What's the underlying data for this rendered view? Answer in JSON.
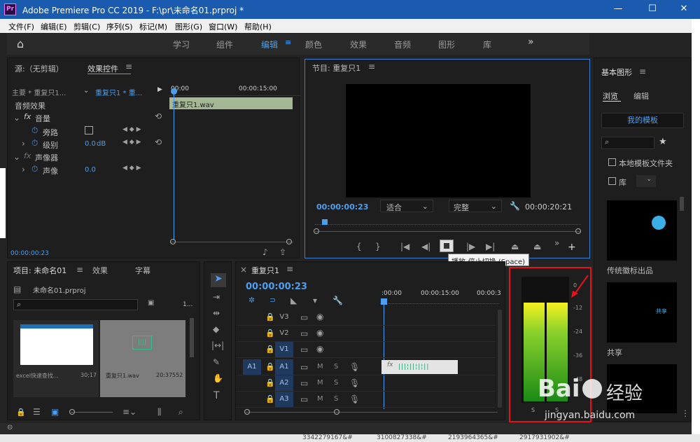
{
  "window": {
    "title": "Adobe Premiere Pro CC 2019 - F:\\pr\\未命名01.prproj *",
    "logo": "Pr",
    "minimize": "—",
    "maximize": "☐",
    "close": "✕"
  },
  "menu": [
    "文件(F)",
    "编辑(E)",
    "剪辑(C)",
    "序列(S)",
    "标记(M)",
    "图形(G)",
    "窗口(W)",
    "帮助(H)"
  ],
  "workspace": {
    "home": "⌂",
    "tabs": [
      "学习",
      "组件",
      "编辑",
      "颜色",
      "效果",
      "音频",
      "图形",
      "库"
    ],
    "active": "编辑",
    "more": "»"
  },
  "source": {
    "tab1": "源:（无剪辑）",
    "tab2": "效果控件",
    "master": "主要 * 重复只1...",
    "seq": "重复只1 * 重...",
    "t0": "00:00",
    "t1": "00:00:15:00",
    "clip": "重复只1.wav",
    "audio_fx": "音频效果",
    "volume": "音量",
    "bypass": "旁路",
    "level": "级别",
    "level_val": "0.0",
    "level_unit": "dB",
    "panner": "声像器",
    "pan": "声像",
    "pan_val": "0.0",
    "tc": "00:00:00:23",
    "fx": "fx"
  },
  "program": {
    "title": "节目: 重复只1",
    "tc": "00:00:00:23",
    "fit": "适合",
    "quality": "完整",
    "duration": "00:00:20:21",
    "tooltip": "播放-停止切换 (Space)"
  },
  "project": {
    "tab1": "项目: 未命名01",
    "tab2": "效果",
    "tab3": "字幕",
    "file": "未命名01.prproj",
    "count": "1...",
    "items": [
      {
        "name": "excel快速查找...",
        "dur": "30;17"
      },
      {
        "name": "重复只1.wav",
        "dur": "20:37552"
      }
    ]
  },
  "timeline": {
    "title": "重复只1",
    "tc": "00:00:00:23",
    "t0": ":00:00",
    "t1": "00:00:15:00",
    "t2": "00:00:3",
    "tracks": [
      "V3",
      "V2",
      "V1",
      "A1",
      "A2",
      "A3"
    ],
    "src": "A1",
    "m": "M",
    "s": "S",
    "fx": "fx"
  },
  "meter": {
    "scale": [
      "0",
      "-12",
      "-24",
      "-36",
      "-48"
    ],
    "s1": "S",
    "s2": "S",
    "level": 0.85
  },
  "essential": {
    "title": "基本图形",
    "browse": "浏览",
    "edit": "编辑",
    "mytemplates": "我的模板",
    "local": "本地模板文件夹",
    "lib": "库",
    "t1": "传统徽标出品",
    "t2": "共享",
    "t2inner": "共享"
  },
  "watermark": {
    "brand": "Bai",
    "brand2": "经验",
    "url": "jingyan.baidu.com"
  },
  "taskbar": [
    "3342279167&#",
    "3100827338&#",
    "2193964365&#",
    "2917931902&#"
  ]
}
